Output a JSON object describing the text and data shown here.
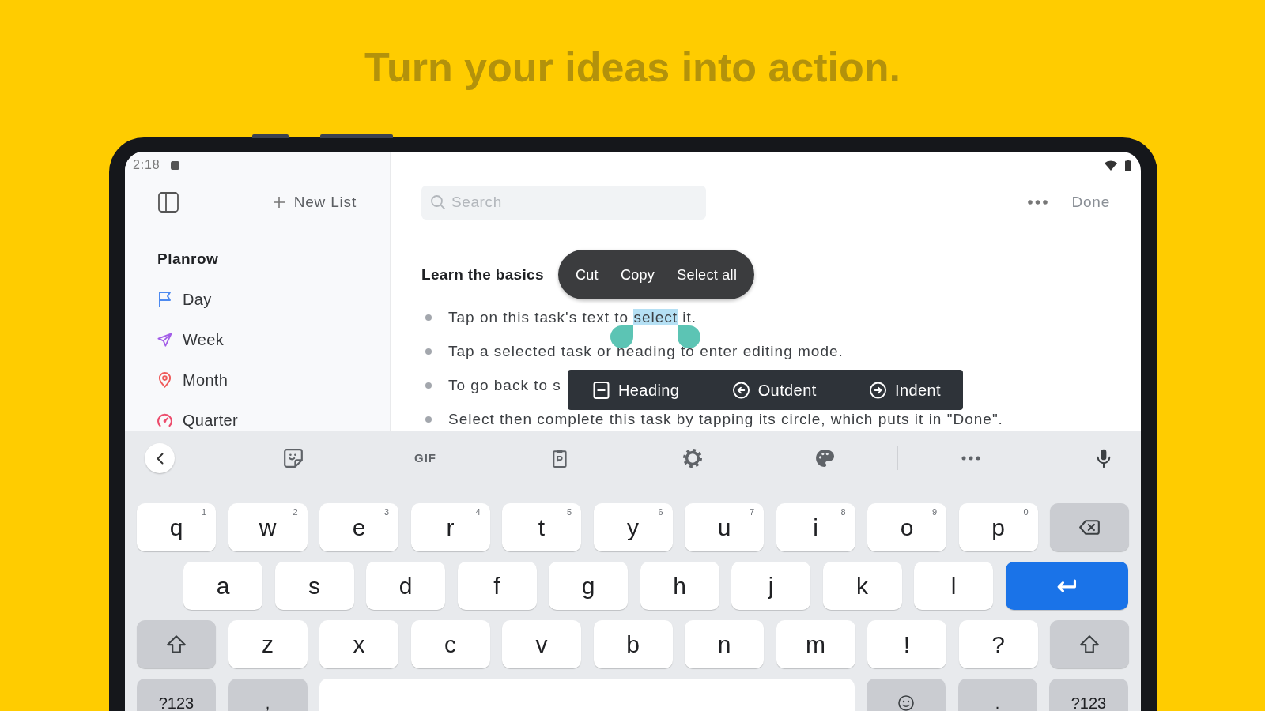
{
  "headline": "Turn your ideas into action.",
  "status_bar": {
    "time": "2:18"
  },
  "sidebar": {
    "new_list": "New List",
    "section": {
      "title": "Planrow",
      "items": [
        {
          "label": "Day",
          "color": "#4d8af0"
        },
        {
          "label": "Week",
          "color": "#a35ee8"
        },
        {
          "label": "Month",
          "color": "#ef5b5b"
        },
        {
          "label": "Quarter",
          "color": "#ec4c6c"
        }
      ]
    }
  },
  "header": {
    "search": {
      "placeholder": "Search"
    },
    "done": "Done"
  },
  "list": {
    "heading": "Learn the basics",
    "tasks": [
      {
        "segments": [
          {
            "text": "Tap on this task's text to ",
            "selected": false
          },
          {
            "text": "select",
            "selected": true
          },
          {
            "text": " it.",
            "selected": false
          }
        ]
      },
      {
        "segments": [
          {
            "text": "Tap a selected task or heading to enter editing mode.",
            "selected": false
          }
        ]
      },
      {
        "segments": [
          {
            "text": "To go back to s",
            "selected": false
          }
        ]
      },
      {
        "segments": [
          {
            "text": "Select then complete this task by tapping its circle, which puts it in \"Done\".",
            "selected": false
          }
        ]
      }
    ]
  },
  "selection_menu": [
    "Cut",
    "Copy",
    "Select all"
  ],
  "format_bar": [
    "Heading",
    "Outdent",
    "Indent"
  ],
  "keyboard": {
    "gif": "GIF",
    "rows": [
      {
        "keys": [
          {
            "kind": "letter",
            "label": "q",
            "hint": "1"
          },
          {
            "kind": "letter",
            "label": "w",
            "hint": "2"
          },
          {
            "kind": "letter",
            "label": "e",
            "hint": "3"
          },
          {
            "kind": "letter",
            "label": "r",
            "hint": "4"
          },
          {
            "kind": "letter",
            "label": "t",
            "hint": "5"
          },
          {
            "kind": "letter",
            "label": "y",
            "hint": "6"
          },
          {
            "kind": "letter",
            "label": "u",
            "hint": "7"
          },
          {
            "kind": "letter",
            "label": "i",
            "hint": "8"
          },
          {
            "kind": "letter",
            "label": "o",
            "hint": "9"
          },
          {
            "kind": "letter",
            "label": "p",
            "hint": "0"
          },
          {
            "kind": "backspace"
          }
        ]
      },
      {
        "keys": [
          {
            "kind": "letter",
            "label": "a"
          },
          {
            "kind": "letter",
            "label": "s"
          },
          {
            "kind": "letter",
            "label": "d"
          },
          {
            "kind": "letter",
            "label": "f"
          },
          {
            "kind": "letter",
            "label": "g"
          },
          {
            "kind": "letter",
            "label": "h"
          },
          {
            "kind": "letter",
            "label": "j"
          },
          {
            "kind": "letter",
            "label": "k"
          },
          {
            "kind": "letter",
            "label": "l"
          },
          {
            "kind": "enter"
          }
        ]
      },
      {
        "keys": [
          {
            "kind": "shift"
          },
          {
            "kind": "letter",
            "label": "z"
          },
          {
            "kind": "letter",
            "label": "x"
          },
          {
            "kind": "letter",
            "label": "c"
          },
          {
            "kind": "letter",
            "label": "v"
          },
          {
            "kind": "letter",
            "label": "b"
          },
          {
            "kind": "letter",
            "label": "n"
          },
          {
            "kind": "letter",
            "label": "m"
          },
          {
            "kind": "letter",
            "label": "!"
          },
          {
            "kind": "letter",
            "label": "?"
          },
          {
            "kind": "shift"
          }
        ]
      },
      {
        "keys": [
          {
            "kind": "symbol",
            "label": "?123"
          },
          {
            "kind": "symbol",
            "label": ","
          },
          {
            "kind": "space"
          },
          {
            "kind": "emoji"
          },
          {
            "kind": "symbol",
            "label": "."
          },
          {
            "kind": "symbol",
            "label": "?123"
          }
        ]
      }
    ]
  }
}
